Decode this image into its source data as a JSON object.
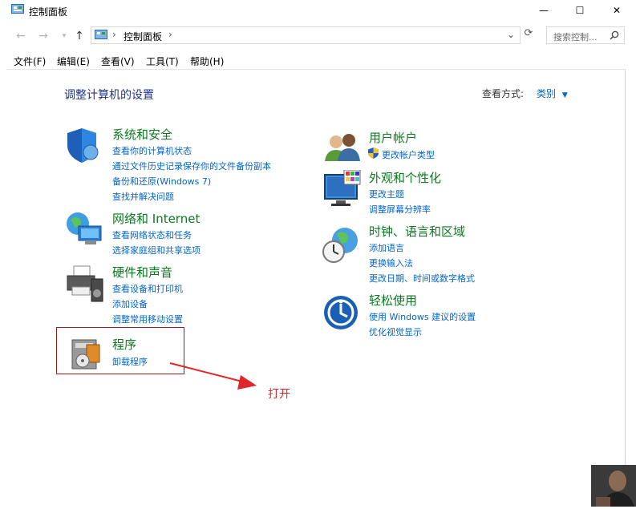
{
  "window": {
    "title": "控制面板",
    "controls": {
      "minimize": "—",
      "maximize": "☐",
      "close": "✕"
    }
  },
  "address": {
    "path": [
      "控制面板"
    ],
    "search_placeholder": "搜索控制..."
  },
  "menu": [
    "文件(F)",
    "编辑(E)",
    "查看(V)",
    "工具(T)",
    "帮助(H)"
  ],
  "main": {
    "heading": "调整计算机的设置",
    "view_by_label": "查看方式:",
    "view_by_value": "类别"
  },
  "categories": [
    {
      "title": "系统和安全",
      "icon": "shield-icon",
      "links": [
        "查看你的计算机状态",
        "通过文件历史记录保存你的文件备份副本",
        "备份和还原(Windows 7)",
        "查找并解决问题"
      ]
    },
    {
      "title": "网络和 Internet",
      "icon": "network-icon",
      "links": [
        "查看网络状态和任务",
        "选择家庭组和共享选项"
      ]
    },
    {
      "title": "硬件和声音",
      "icon": "printer-icon",
      "links": [
        "查看设备和打印机",
        "添加设备",
        "调整常用移动设置"
      ]
    },
    {
      "title": "程序",
      "icon": "programs-icon",
      "links": [
        "卸载程序"
      ]
    },
    {
      "title": "用户帐户",
      "icon": "users-icon",
      "links": [
        "更改帐户类型"
      ]
    },
    {
      "title": "外观和个性化",
      "icon": "monitor-icon",
      "links": [
        "更改主题",
        "调整屏幕分辨率"
      ]
    },
    {
      "title": "时钟、语言和区域",
      "icon": "clock-globe-icon",
      "links": [
        "添加语言",
        "更换输入法",
        "更改日期、时间或数字格式"
      ]
    },
    {
      "title": "轻松使用",
      "icon": "ease-of-access-icon",
      "links": [
        "使用 Windows 建议的设置",
        "优化视觉显示"
      ]
    }
  ],
  "annotation": {
    "text": "打开",
    "color": "#e0262a"
  },
  "colors": {
    "category_title": "#0b7a1f",
    "link": "#0066cc",
    "heading": "#1e3287"
  }
}
